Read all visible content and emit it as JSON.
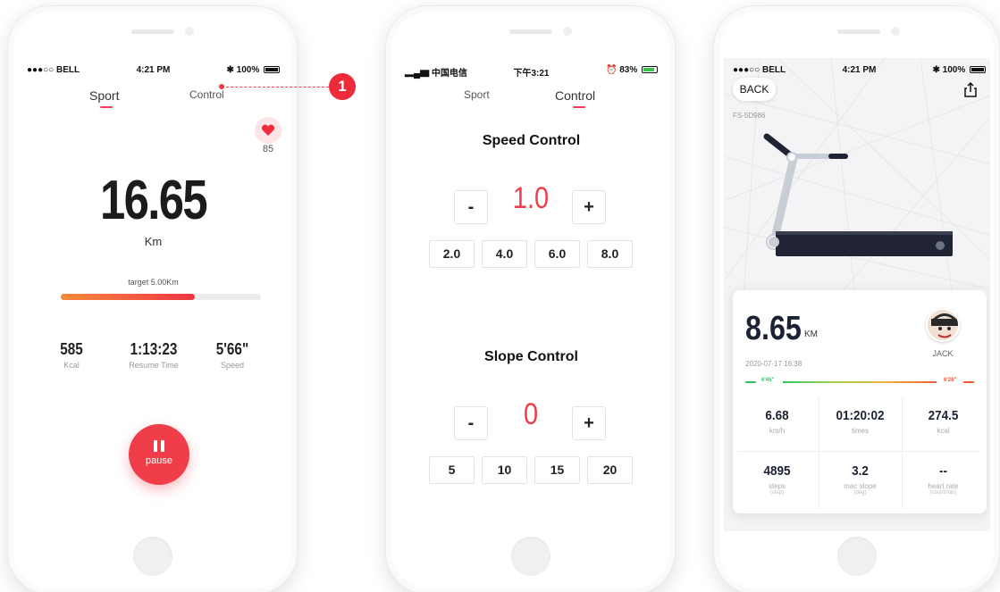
{
  "colors": {
    "accent": "#ef3e4a"
  },
  "phone1": {
    "status": {
      "carrier": "●●●○○ BELL",
      "time": "4:21 PM",
      "battery": "100%"
    },
    "tabs": {
      "sport": "Sport",
      "control": "Control"
    },
    "heart_rate": "85",
    "distance": "16.65",
    "distance_unit": "Km",
    "target": "target 5.00Km",
    "progress_fraction": 0.67,
    "stats": [
      {
        "value": "585",
        "label": "Kcal"
      },
      {
        "value": "1:13:23",
        "label": "Resume Time"
      },
      {
        "value": "5'66\"",
        "label": "Speed"
      }
    ],
    "pause_label": "pause",
    "callout_number": "1"
  },
  "phone2": {
    "status": {
      "carrier": "中国电信",
      "time": "下午3:21",
      "battery": "83%"
    },
    "tabs": {
      "sport": "Sport",
      "control": "Control"
    },
    "speed": {
      "title": "Speed Control",
      "minus": "-",
      "plus": "+",
      "value": "1.0",
      "presets": [
        "2.0",
        "4.0",
        "6.0",
        "8.0"
      ]
    },
    "slope": {
      "title": "Slope Control",
      "minus": "-",
      "plus": "+",
      "value": "0",
      "presets": [
        "5",
        "10",
        "15",
        "20"
      ]
    }
  },
  "phone3": {
    "status": {
      "carrier": "●●●○○ BELL",
      "time": "4:21 PM",
      "battery": "100%"
    },
    "back_label": "BACK",
    "device_id": "FS-5D986",
    "distance": "8.65",
    "distance_unit": "KM",
    "date": "2020-07-17 16:38",
    "user_name": "JACK",
    "pace_min": "6'45\"",
    "pace_max": "6'28\"",
    "stats": [
      {
        "value": "6.68",
        "label": "km/h",
        "sub": ""
      },
      {
        "value": "01:20:02",
        "label": "times",
        "sub": ""
      },
      {
        "value": "274.5",
        "label": "kcal",
        "sub": ""
      },
      {
        "value": "4895",
        "label": "steps",
        "sub": "(step)"
      },
      {
        "value": "3.2",
        "label": "mac slope",
        "sub": "(deg)"
      },
      {
        "value": "--",
        "label": "heart rate",
        "sub": "(count/min)"
      }
    ]
  }
}
